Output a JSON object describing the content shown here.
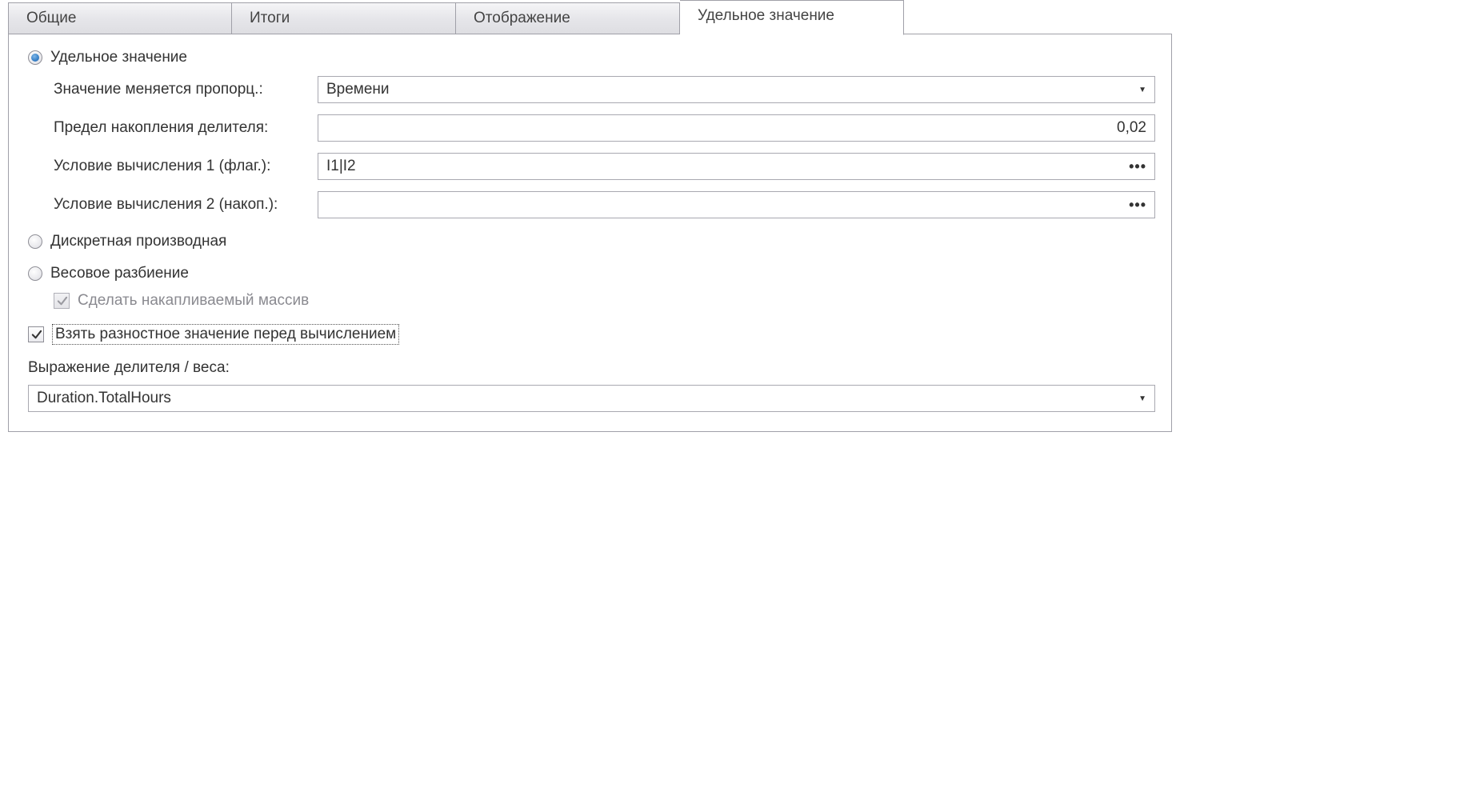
{
  "tabs": [
    {
      "label": "Общие"
    },
    {
      "label": "Итоги"
    },
    {
      "label": "Отображение"
    },
    {
      "label": "Удельное значение",
      "active": true
    }
  ],
  "radio": {
    "specific_value": {
      "label": "Удельное значение",
      "checked": true
    },
    "discrete_derivative": {
      "label": "Дискретная производная",
      "checked": false
    },
    "weight_split": {
      "label": "Весовое разбиение",
      "checked": false
    }
  },
  "fields": {
    "proportional": {
      "label": "Значение меняется пропорц.:",
      "value": "Времени"
    },
    "divisor_limit": {
      "label": "Предел накопления делителя:",
      "value": "0,02"
    },
    "condition1": {
      "label": "Условие вычисления 1 (флаг.):",
      "value": "I1|I2"
    },
    "condition2": {
      "label": "Условие вычисления 2 (накоп.):",
      "value": ""
    }
  },
  "checks": {
    "make_accum_array": {
      "label": "Сделать накапливаемый массив",
      "checked": true,
      "disabled": true
    },
    "take_diff_before": {
      "label": "Взять разностное значение перед вычислением",
      "checked": true,
      "focused": true
    }
  },
  "divisor_expr": {
    "label": "Выражение делителя / веса:",
    "value": "Duration.TotalHours"
  }
}
